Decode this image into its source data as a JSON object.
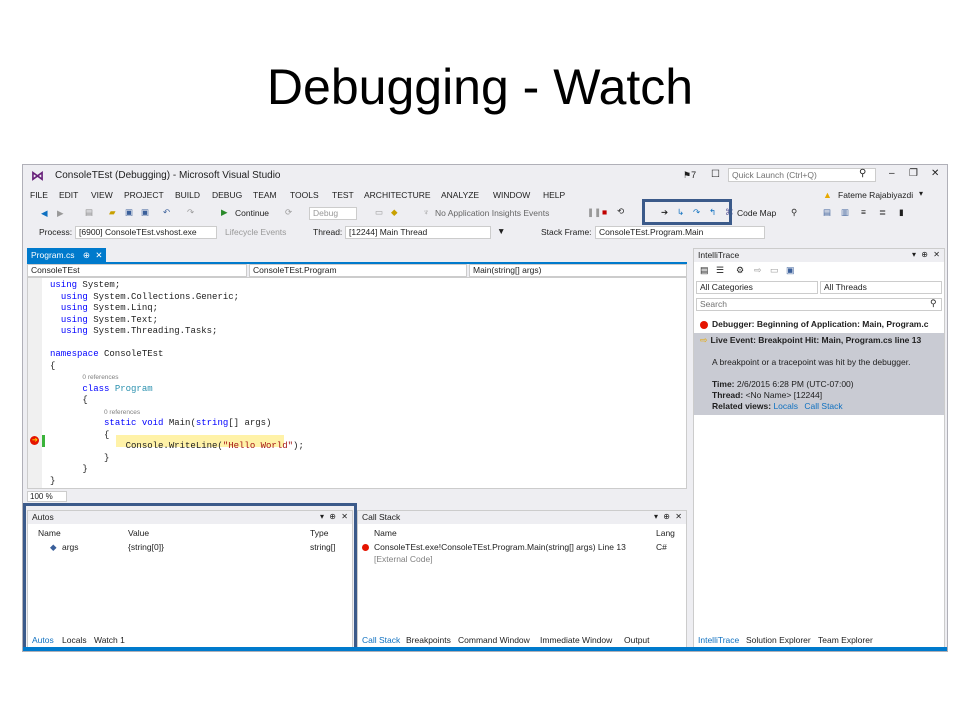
{
  "slide": {
    "title": "Debugging - Watch"
  },
  "window": {
    "title": "ConsoleTEst (Debugging) - Microsoft Visual Studio",
    "notifications": "7",
    "quick_launch_placeholder": "Quick Launch (Ctrl+Q)",
    "user": "Fateme Rajabiyazdi"
  },
  "menu": [
    "FILE",
    "EDIT",
    "VIEW",
    "PROJECT",
    "BUILD",
    "DEBUG",
    "TEAM",
    "TOOLS",
    "TEST",
    "ARCHITECTURE",
    "ANALYZE",
    "WINDOW",
    "HELP"
  ],
  "toolbar": {
    "continue": "Continue",
    "config": "Debug",
    "insights": "No Application Insights Events",
    "code_map": "Code Map"
  },
  "debug_location": {
    "process_label": "Process:",
    "process": "[6900] ConsoleTEst.vshost.exe",
    "lifecycle": "Lifecycle Events",
    "thread_label": "Thread:",
    "thread": "[12244] Main Thread",
    "stack_frame_label": "Stack Frame:",
    "stack_frame": "ConsoleTEst.Program.Main"
  },
  "editor": {
    "tab": "Program.cs",
    "nav_project": "ConsoleTEst",
    "nav_class": "ConsoleTEst.Program",
    "nav_member": "Main(string[] args)",
    "zoom": "100 %",
    "refs": "0 references"
  },
  "autos": {
    "title": "Autos",
    "columns": [
      "Name",
      "Value",
      "Type"
    ],
    "rows": [
      {
        "name": "args",
        "value": "{string[0]}",
        "type": "string[]"
      }
    ],
    "tabs": [
      "Autos",
      "Locals",
      "Watch 1"
    ]
  },
  "call_stack": {
    "title": "Call Stack",
    "columns": [
      "Name",
      "Lang"
    ],
    "rows": [
      {
        "name": "ConsoleTEst.exe!ConsoleTEst.Program.Main(string[] args) Line 13",
        "lang": "C#"
      },
      {
        "name": "[External Code]",
        "lang": ""
      }
    ],
    "tabs": [
      "Call Stack",
      "Breakpoints",
      "Command Window",
      "Immediate Window",
      "Output"
    ]
  },
  "intellitrace": {
    "title": "IntelliTrace",
    "categories": "All Categories",
    "threads": "All Threads",
    "search_placeholder": "Search",
    "event1": "Debugger: Beginning of Application: Main, Program.c",
    "event2": "Live Event: Breakpoint Hit: Main, Program.cs line 13",
    "event2_desc": "A breakpoint or a tracepoint was hit by the debugger.",
    "time_label": "Time:",
    "time": "2/6/2015 6:28 PM (UTC-07:00)",
    "thread_label": "Thread:",
    "thread": "<No Name> [12244]",
    "related_label": "Related views:",
    "related_locals": "Locals",
    "related_callstack": "Call Stack",
    "tabs": [
      "IntelliTrace",
      "Solution Explorer",
      "Team Explorer"
    ]
  },
  "colors": {
    "accent": "#007acc",
    "highlight_box": "#3b5a8a",
    "breakpoint": "#e51400",
    "current_line": "#fff2a8"
  }
}
